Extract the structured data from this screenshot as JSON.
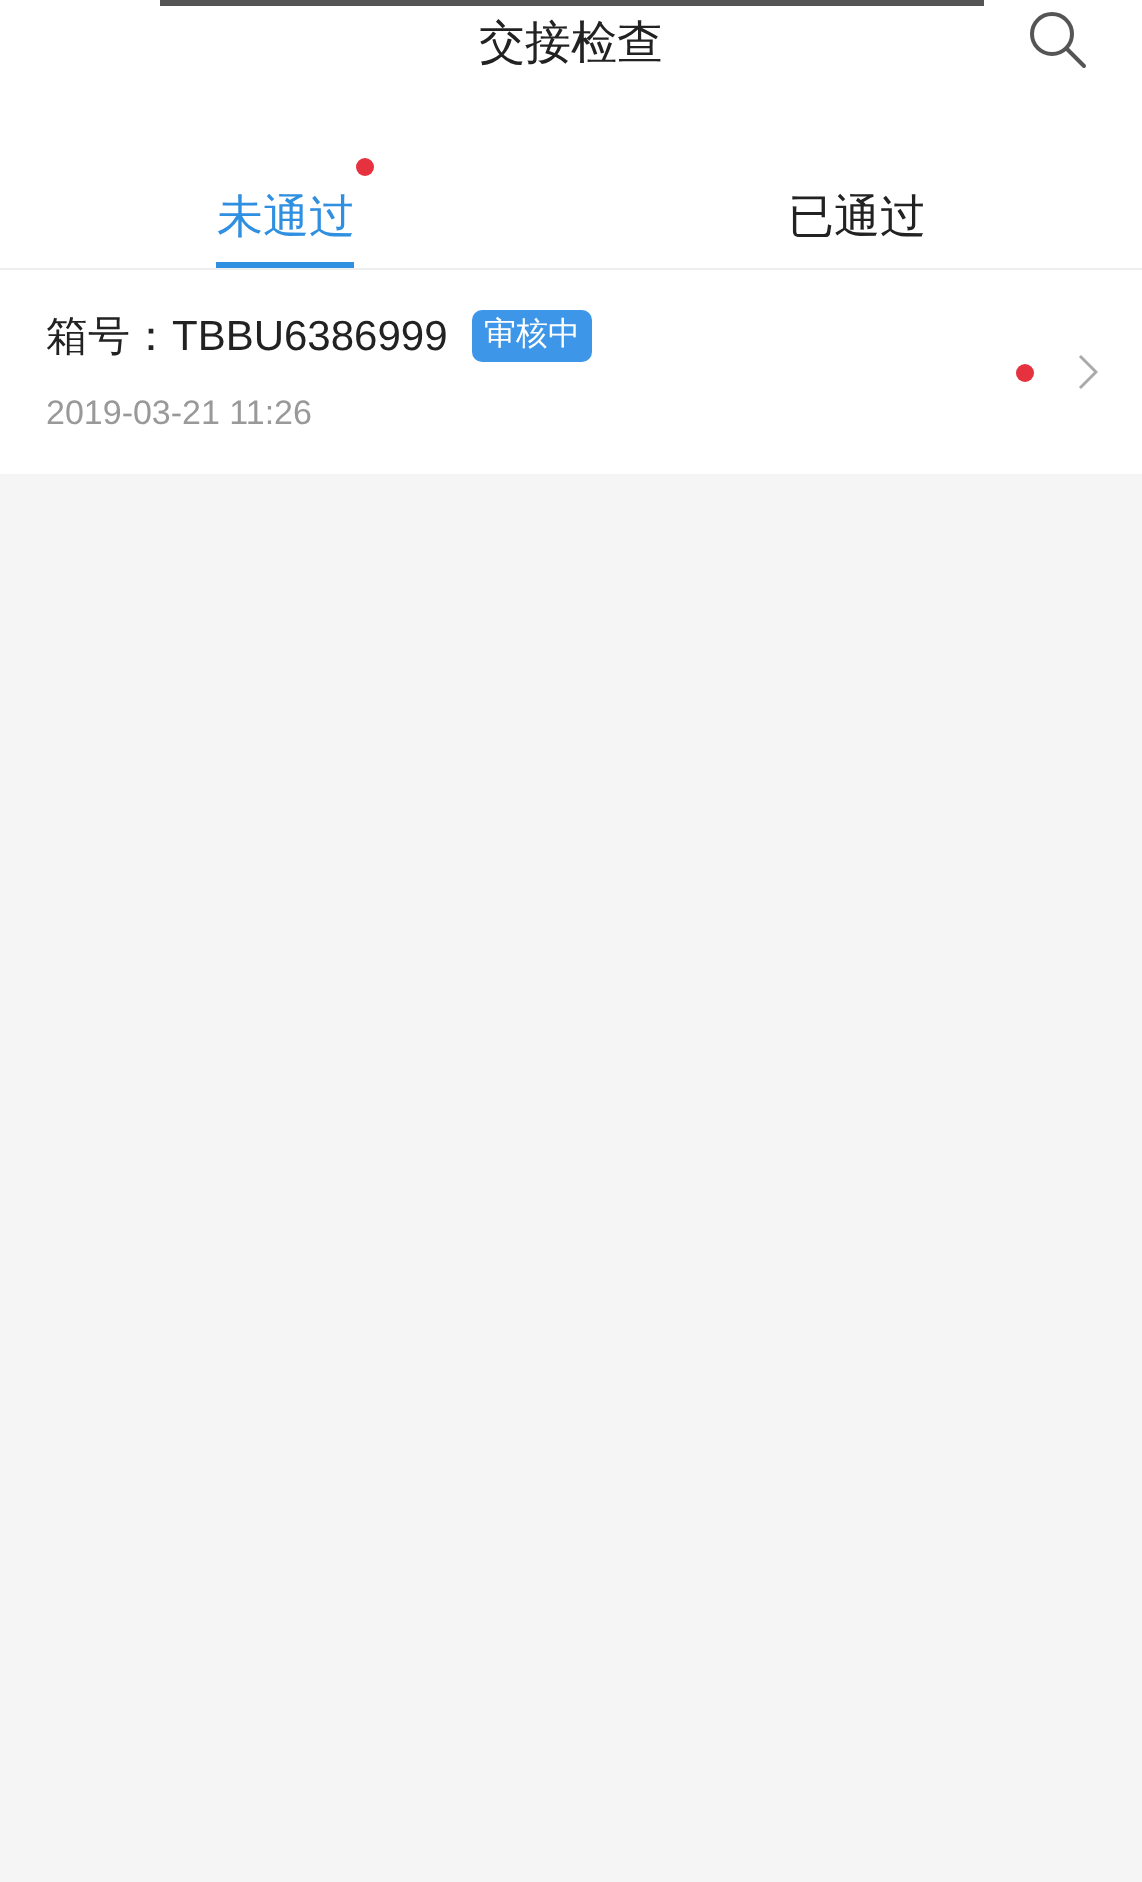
{
  "header": {
    "title": "交接检查"
  },
  "tabs": [
    {
      "label": "未通过",
      "selected": true,
      "badge": true
    },
    {
      "label": "已通过",
      "selected": false,
      "badge": false
    }
  ],
  "items": [
    {
      "label": "箱号：TBBU6386999",
      "status": "审核中",
      "time": "2019-03-21 11:26",
      "unread": true
    }
  ]
}
